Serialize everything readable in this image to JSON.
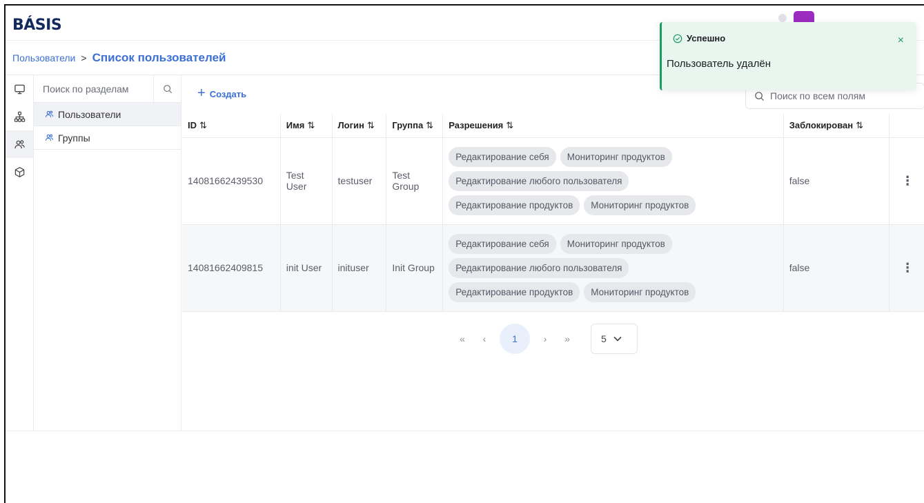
{
  "app": {
    "logo": "BÁSIS"
  },
  "breadcrumb": {
    "parent": "Пользователи",
    "separator": ">",
    "current": "Список пользователей"
  },
  "rail": {
    "items": [
      "monitor-icon",
      "hierarchy-icon",
      "users-icon",
      "cube-icon"
    ],
    "active_index": 2
  },
  "panel": {
    "search_placeholder": "Поиск по разделам",
    "items": [
      {
        "label": "Пользователи",
        "icon": "users-icon"
      },
      {
        "label": "Группы",
        "icon": "users-icon"
      }
    ]
  },
  "toolbar": {
    "create_label": "Создать",
    "search_placeholder": "Поиск по всем полям"
  },
  "table": {
    "sort_glyph": "⇅",
    "columns": [
      "ID",
      "Имя",
      "Логин",
      "Группа",
      "Разрешения",
      "Заблокирован"
    ],
    "rows": [
      {
        "id": "14081662439530",
        "name": "Test User",
        "login": "testuser",
        "group": "Test Group",
        "permissions": [
          [
            "Редактирование себя",
            "Мониторинг продуктов"
          ],
          [
            "Редактирование любого пользователя"
          ],
          [
            "Редактирование продуктов",
            "Мониторинг продуктов"
          ]
        ],
        "blocked": "false"
      },
      {
        "id": "14081662409815",
        "name": "init User",
        "login": "inituser",
        "group": "Init Group",
        "permissions": [
          [
            "Редактирование себя",
            "Мониторинг продуктов"
          ],
          [
            "Редактирование любого пользователя"
          ],
          [
            "Редактирование продуктов",
            "Мониторинг продуктов"
          ]
        ],
        "blocked": "false"
      }
    ]
  },
  "pagination": {
    "first": "«",
    "prev": "‹",
    "current_page": "1",
    "next": "›",
    "last": "»",
    "page_size": "5"
  },
  "toast": {
    "title": "Успешно",
    "message": "Пользователь удалён",
    "close": "×",
    "color": "#1c9b63"
  },
  "colors": {
    "accent": "#3b6fd6",
    "brand": "#152a5c"
  }
}
